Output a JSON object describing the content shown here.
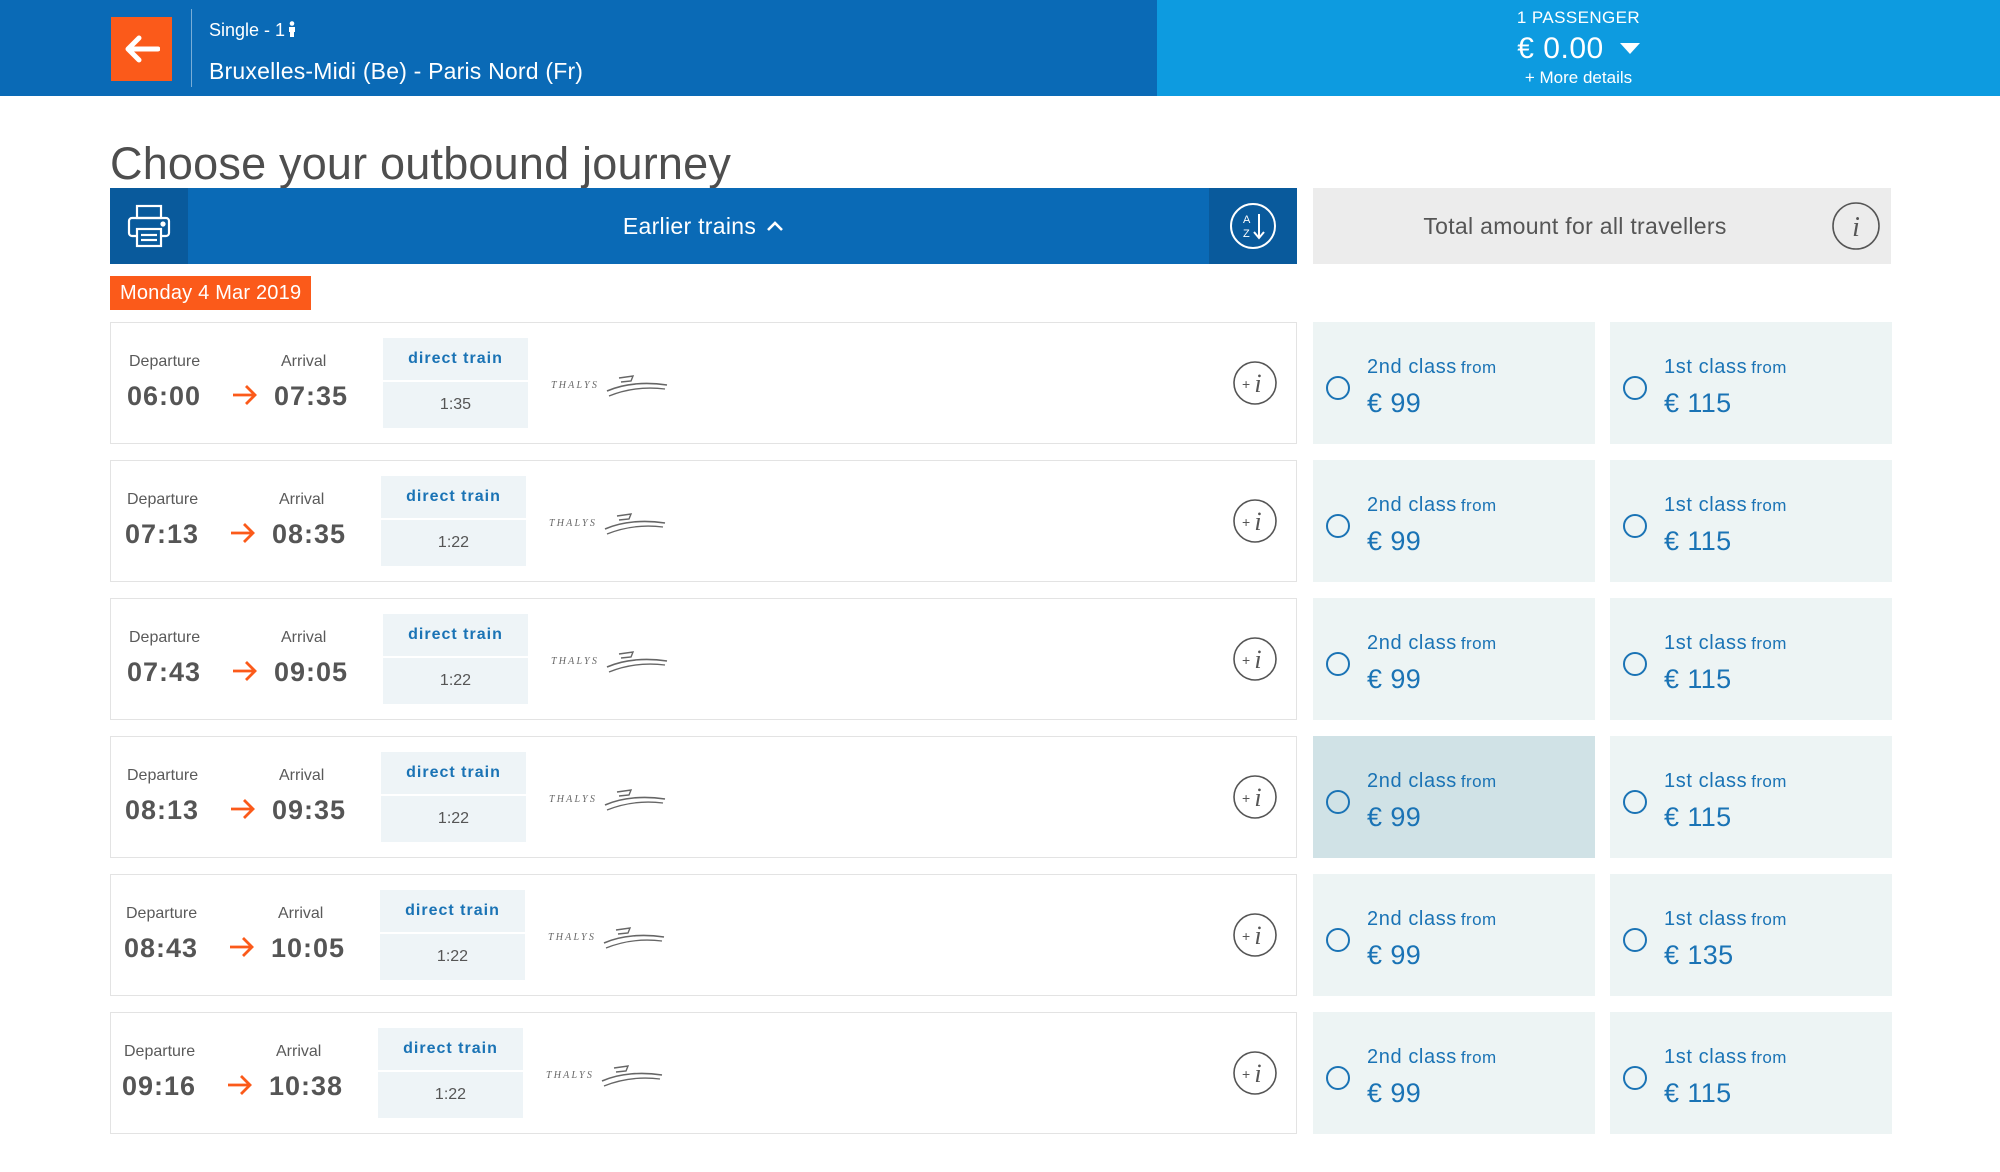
{
  "header": {
    "trip_type": "Single - 1",
    "route": "Bruxelles-Midi (Be) - Paris Nord (Fr)",
    "passenger_count": "1 PASSENGER",
    "total_price": "€ 0.00",
    "more_details": "+ More details"
  },
  "page_title": "Choose your outbound journey",
  "toolbar": {
    "earlier_label": "Earlier trains"
  },
  "total_box": {
    "label": "Total amount for all travellers"
  },
  "date": "Monday 4 Mar 2019",
  "labels": {
    "departure": "Departure",
    "arrival": "Arrival",
    "second_class": "2nd class",
    "first_class": "1st class",
    "from": "from",
    "operator_logo_text": "THALYS"
  },
  "journeys": [
    {
      "departure": "06:00",
      "arrival": "07:35",
      "type": "direct train",
      "duration": "1:35",
      "second_price": "€ 99",
      "first_price": "€ 115",
      "second_highlighted": false
    },
    {
      "departure": "07:13",
      "arrival": "08:35",
      "type": "direct train",
      "duration": "1:22",
      "second_price": "€ 99",
      "first_price": "€ 115",
      "second_highlighted": false
    },
    {
      "departure": "07:43",
      "arrival": "09:05",
      "type": "direct train",
      "duration": "1:22",
      "second_price": "€ 99",
      "first_price": "€ 115",
      "second_highlighted": false
    },
    {
      "departure": "08:13",
      "arrival": "09:35",
      "type": "direct train",
      "duration": "1:22",
      "second_price": "€ 99",
      "first_price": "€ 115",
      "second_highlighted": true
    },
    {
      "departure": "08:43",
      "arrival": "10:05",
      "type": "direct train",
      "duration": "1:22",
      "second_price": "€ 99",
      "first_price": "€ 135",
      "second_highlighted": false
    },
    {
      "departure": "09:16",
      "arrival": "10:38",
      "type": "direct train",
      "duration": "1:22",
      "second_price": "€ 99",
      "first_price": "€ 115",
      "second_highlighted": false
    }
  ],
  "colors": {
    "header_blue": "#0a6ab6",
    "header_light_blue": "#0d9be0",
    "accent_orange": "#fb5a1a",
    "link_blue": "#1a73b5",
    "fare_bg": "#edf4f4",
    "fare_highlight_bg": "#d0e2e6"
  },
  "icons": {
    "back": "arrow-left-icon",
    "passenger": "person-icon",
    "dropdown": "caret-down-icon",
    "print": "printer-icon",
    "earlier": "chevron-up-icon",
    "sort": "sort-az-icon",
    "info": "info-icon",
    "journey_info": "plus-info-icon",
    "direction": "arrow-right-icon"
  }
}
